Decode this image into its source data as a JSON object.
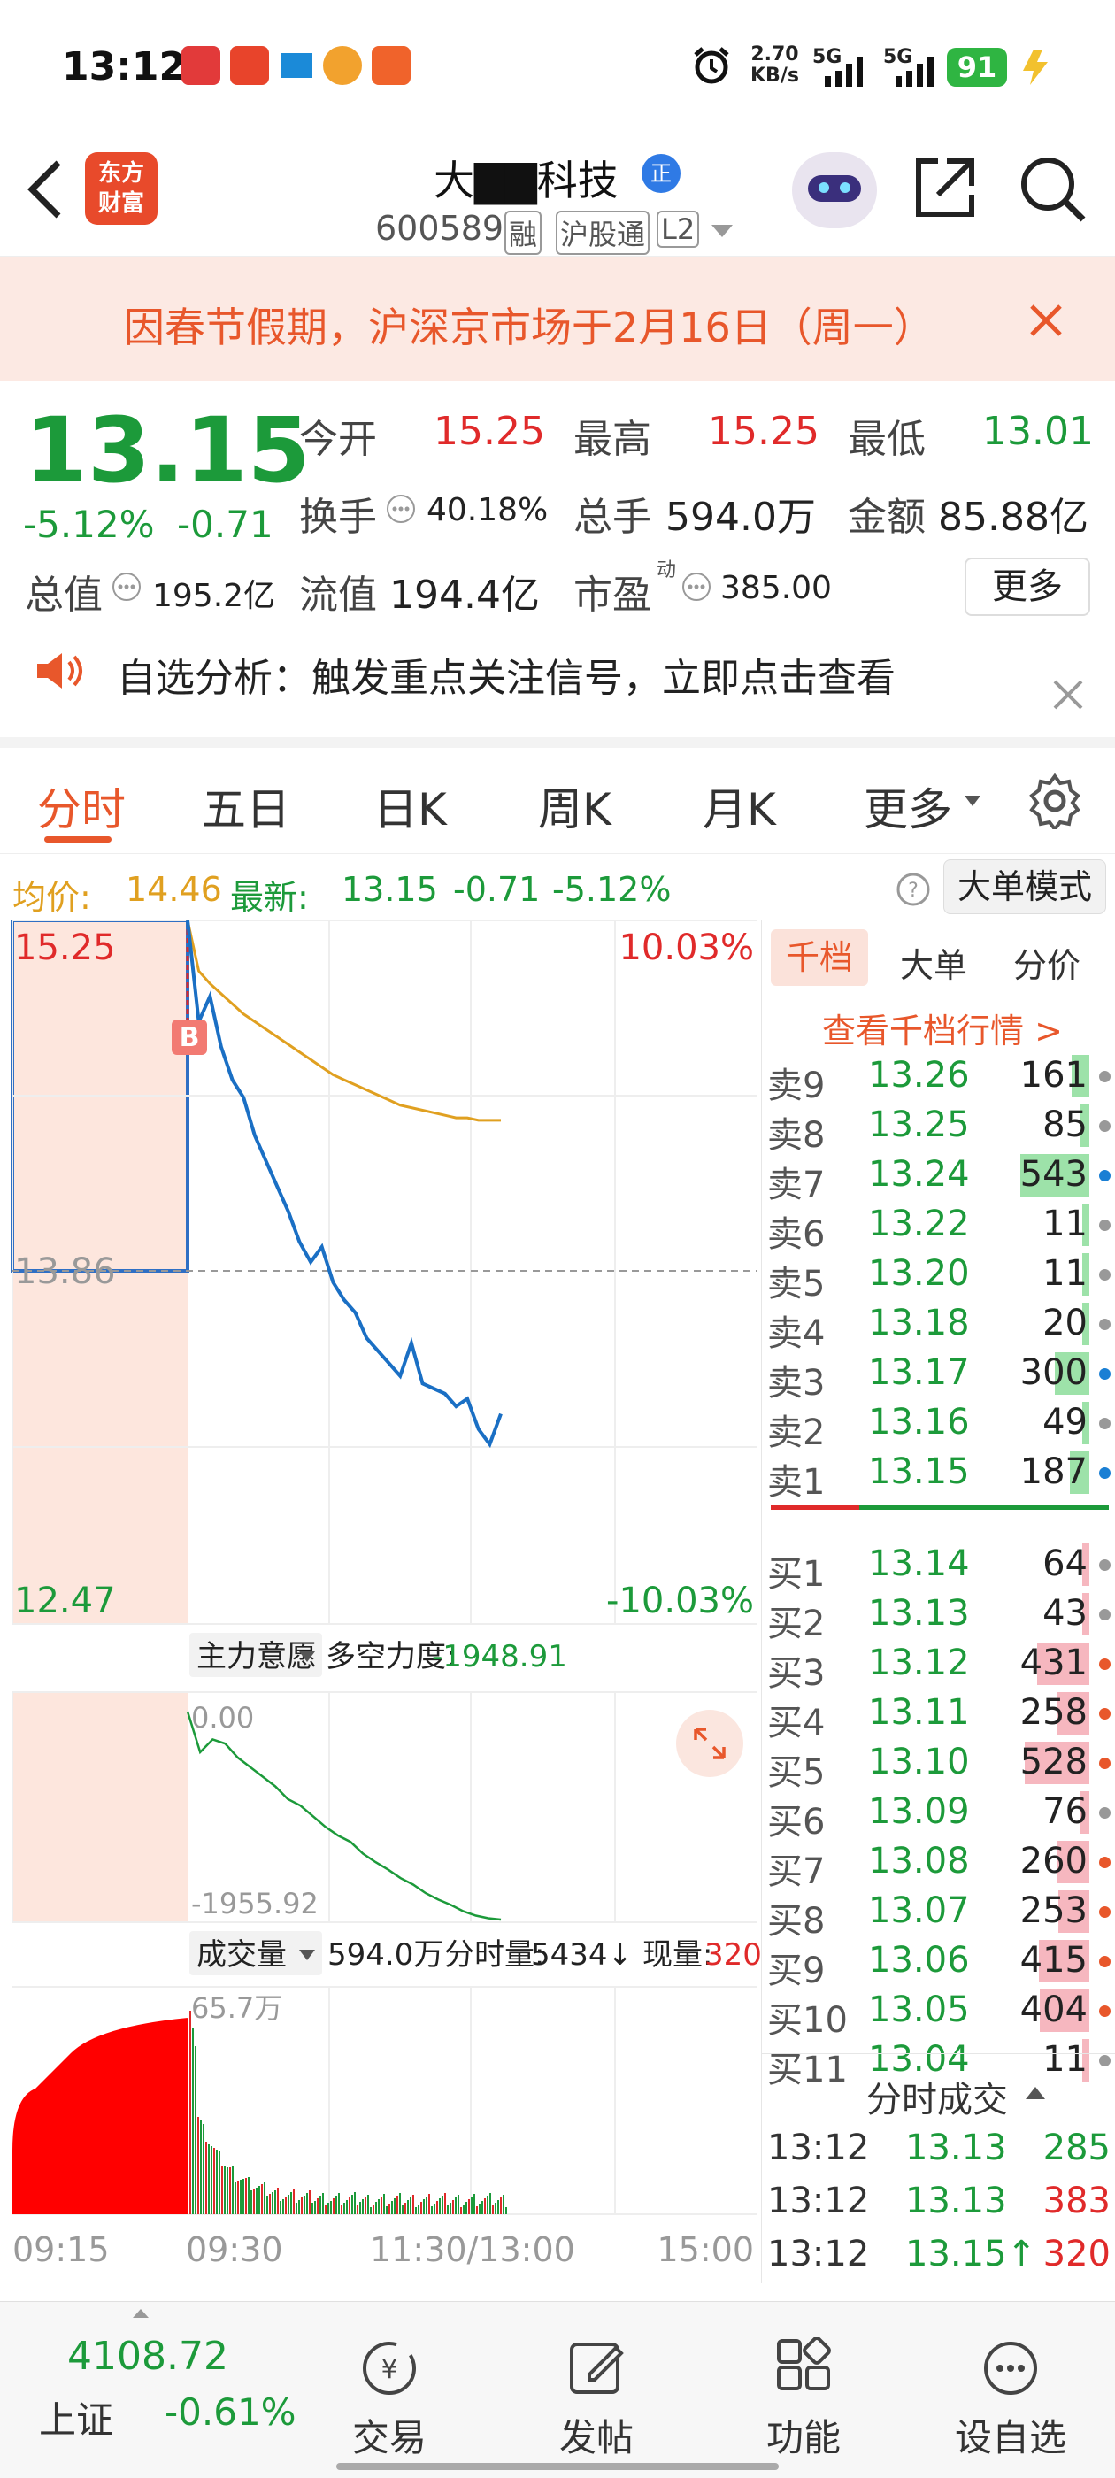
{
  "status_bar": {
    "time": "13:12",
    "net_speed": "2.70",
    "net_unit": "KB/s",
    "sig1": "5G",
    "sig2": "5G",
    "battery": "91"
  },
  "nav": {
    "logo_line1": "东方",
    "logo_line2": "财富",
    "stock_name": "大▇▇科技",
    "stock_code": "600589",
    "tag_margin": "融",
    "tag_connect": "沪股通",
    "tag_level": "L2"
  },
  "banner": {
    "text": "因春节假期，沪深京市场于2月16日（周一）"
  },
  "quote": {
    "price": "13.15",
    "change_pct": "-5.12%",
    "change": "-0.71",
    "open_label": "今开",
    "open": "15.25",
    "high_label": "最高",
    "high": "15.25",
    "low_label": "最低",
    "low": "13.01",
    "turnover_label": "换手",
    "turnover": "40.18%",
    "volume_label": "总手",
    "volume": "594.0万",
    "amount_label": "金额",
    "amount": "85.88亿",
    "mktcap_label": "总值",
    "mktcap": "195.2亿",
    "float_label": "流值",
    "float": "194.4亿",
    "pe_label": "市盈",
    "pe_sup": "动",
    "pe": "385.00",
    "more_button": "更多"
  },
  "notice": {
    "text": "自选分析：触发重点关注信号，立即点击查看"
  },
  "tabs": [
    "分时",
    "五日",
    "日K",
    "周K",
    "月K",
    "更多"
  ],
  "info_bar": {
    "avg_label": "均价:",
    "avg": "14.46",
    "latest_label": "最新:",
    "latest": "13.15",
    "latest_change": "-0.71",
    "latest_pct": "-5.12%",
    "mode_button": "大单模式"
  },
  "chart": {
    "price_top": "15.25",
    "price_mid": "13.86",
    "price_bottom": "12.47",
    "pct_top": "10.03%",
    "pct_bottom": "-10.03%",
    "b_marker": "B",
    "indicator_select": "主力意愿",
    "indicator_label": "多空力度:",
    "indicator_value": "-1948.91",
    "ind_top": "0.00",
    "ind_bottom": "-1955.92",
    "vol_select": "成交量",
    "vol_total": "594.0万",
    "vol_tick_label": "分时量:",
    "vol_tick": "5434↓",
    "vol_now_label": "现量:",
    "vol_now": "320",
    "vol_max": "65.7万",
    "time_labels": [
      "09:15",
      "09:30",
      "11:30/13:00",
      "15:00"
    ]
  },
  "chart_data": {
    "type": "line",
    "title": "",
    "x": [
      "09:30",
      "09:35",
      "09:40",
      "09:45",
      "09:50",
      "09:55",
      "10:00",
      "10:05",
      "10:10",
      "10:15",
      "10:20",
      "10:25",
      "10:30",
      "10:35",
      "10:40",
      "10:45",
      "10:50",
      "10:55",
      "11:00",
      "11:05",
      "11:10",
      "11:15",
      "11:20",
      "11:25",
      "11:30",
      "13:00",
      "13:05",
      "13:10",
      "13:12"
    ],
    "series": [
      {
        "values": [
          15.25,
          14.85,
          14.95,
          14.75,
          14.62,
          14.55,
          14.4,
          14.3,
          14.2,
          14.1,
          13.98,
          13.9,
          13.96,
          13.82,
          13.75,
          13.7,
          13.6,
          13.55,
          13.5,
          13.45,
          13.58,
          13.42,
          13.4,
          13.38,
          13.33,
          13.36,
          13.24,
          13.18,
          13.3
        ]
      },
      {
        "values": [
          15.25,
          15.05,
          15.0,
          14.96,
          14.92,
          14.88,
          14.85,
          14.82,
          14.79,
          14.76,
          14.73,
          14.7,
          14.67,
          14.64,
          14.62,
          14.6,
          14.58,
          14.56,
          14.54,
          14.52,
          14.51,
          14.5,
          14.49,
          14.48,
          14.47,
          14.47,
          14.46,
          14.46,
          14.46
        ]
      }
    ],
    "ylim": [
      12.47,
      15.25
    ]
  },
  "depth": {
    "tabs": [
      "千档",
      "大单",
      "分价"
    ],
    "view_more": "查看千档行情 >",
    "sells": [
      {
        "label": "卖9",
        "price": "13.26",
        "vol": "161",
        "bar": 0.14,
        "dot": "#999999"
      },
      {
        "label": "卖8",
        "price": "13.25",
        "vol": "85",
        "bar": 0.08,
        "dot": "#999999"
      },
      {
        "label": "卖7",
        "price": "13.24",
        "vol": "543",
        "bar": 0.56,
        "dot": "#1a7fd4"
      },
      {
        "label": "卖6",
        "price": "13.22",
        "vol": "11",
        "bar": 0.02,
        "dot": "#999999"
      },
      {
        "label": "卖5",
        "price": "13.20",
        "vol": "11",
        "bar": 0.02,
        "dot": "#999999"
      },
      {
        "label": "卖4",
        "price": "13.18",
        "vol": "20",
        "bar": 0.03,
        "dot": "#999999"
      },
      {
        "label": "卖3",
        "price": "13.17",
        "vol": "300",
        "bar": 0.28,
        "dot": "#1a7fd4"
      },
      {
        "label": "卖2",
        "price": "13.16",
        "vol": "49",
        "bar": 0.05,
        "dot": "#999999"
      },
      {
        "label": "卖1",
        "price": "13.15",
        "vol": "187",
        "bar": 0.16,
        "dot": "#1a7fd4"
      }
    ],
    "buys": [
      {
        "label": "买1",
        "price": "13.14",
        "vol": "64",
        "bar": 0.05,
        "dot": "#999999"
      },
      {
        "label": "买2",
        "price": "13.13",
        "vol": "43",
        "bar": 0.04,
        "dot": "#999999"
      },
      {
        "label": "买3",
        "price": "13.12",
        "vol": "431",
        "bar": 0.42,
        "dot": "#e8572b"
      },
      {
        "label": "买4",
        "price": "13.11",
        "vol": "258",
        "bar": 0.26,
        "dot": "#e8572b"
      },
      {
        "label": "买5",
        "price": "13.10",
        "vol": "528",
        "bar": 0.52,
        "dot": "#e8572b"
      },
      {
        "label": "买6",
        "price": "13.09",
        "vol": "76",
        "bar": 0.07,
        "dot": "#999999"
      },
      {
        "label": "买7",
        "price": "13.08",
        "vol": "260",
        "bar": 0.26,
        "dot": "#e8572b"
      },
      {
        "label": "买8",
        "price": "13.07",
        "vol": "253",
        "bar": 0.25,
        "dot": "#e8572b"
      },
      {
        "label": "买9",
        "price": "13.06",
        "vol": "415",
        "bar": 0.41,
        "dot": "#e8572b"
      },
      {
        "label": "买10",
        "price": "13.05",
        "vol": "404",
        "bar": 0.4,
        "dot": "#e8572b"
      },
      {
        "label": "买11",
        "price": "13.04",
        "vol": "11",
        "bar": 0.02,
        "dot": "#999999"
      }
    ],
    "ticks_title": "分时成交",
    "ticks": [
      {
        "time": "13:12",
        "price": "13.13",
        "vol": "285",
        "color": "#1c9a3a"
      },
      {
        "time": "13:12",
        "price": "13.13",
        "vol": "383",
        "color": "#e02a2a"
      },
      {
        "time": "13:12",
        "price": "13.15↑",
        "vol": "320",
        "color": "#e02a2a"
      }
    ]
  },
  "bottom": {
    "index_value": "4108.72",
    "index_name": "上证",
    "index_change": "-0.61%",
    "items": [
      "交易",
      "发帖",
      "功能",
      "设自选"
    ]
  }
}
